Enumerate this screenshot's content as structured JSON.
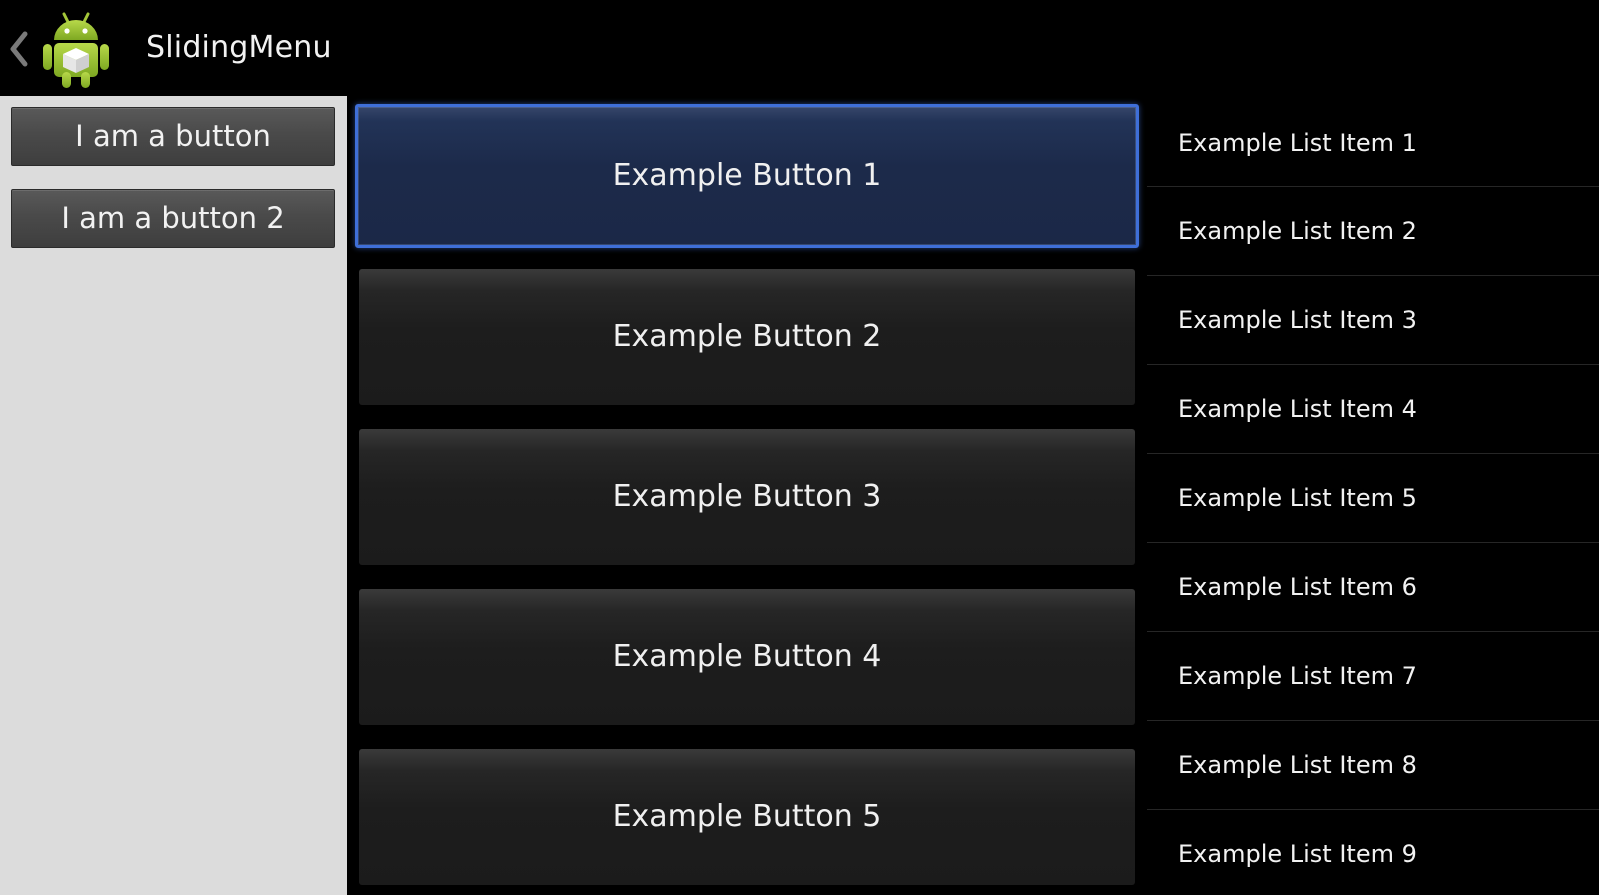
{
  "action_bar": {
    "title": "SlidingMenu",
    "up_icon": "chevron-left-icon",
    "app_icon": "android-robot-icon"
  },
  "menu": {
    "buttons": [
      {
        "label": "I am a button"
      },
      {
        "label": "I am a button 2"
      }
    ],
    "background": "#dcdcdc"
  },
  "content": {
    "buttons": [
      {
        "label": "Example Button 1",
        "focused": true
      },
      {
        "label": "Example Button 2",
        "focused": false
      },
      {
        "label": "Example Button 3",
        "focused": false
      },
      {
        "label": "Example Button 4",
        "focused": false
      },
      {
        "label": "Example Button 5",
        "focused": false
      }
    ],
    "focus_color": "#3f6fd8"
  },
  "list": {
    "items": [
      {
        "label": "Example List Item 1"
      },
      {
        "label": "Example List Item 2"
      },
      {
        "label": "Example List Item 3"
      },
      {
        "label": "Example List Item 4"
      },
      {
        "label": "Example List Item 5"
      },
      {
        "label": "Example List Item 6"
      },
      {
        "label": "Example List Item 7"
      },
      {
        "label": "Example List Item 8"
      },
      {
        "label": "Example List Item 9"
      }
    ]
  }
}
